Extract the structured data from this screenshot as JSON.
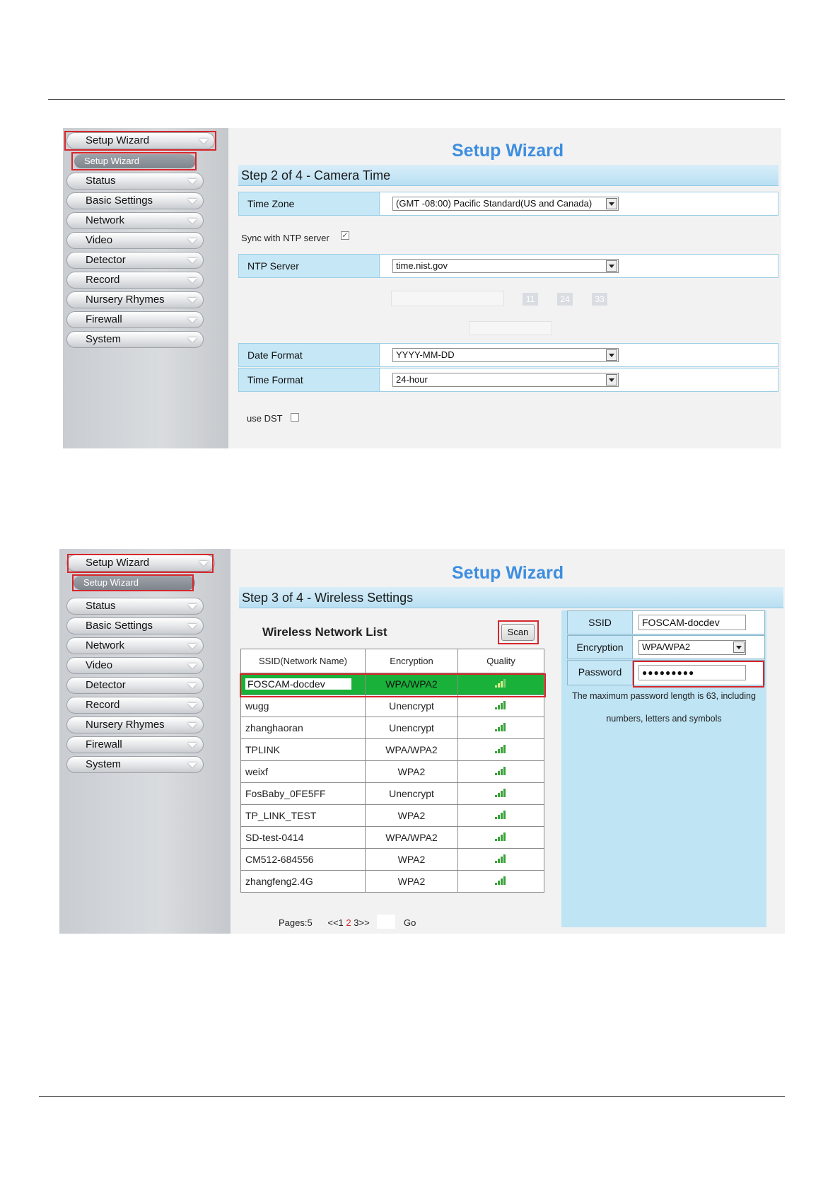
{
  "screen1": {
    "menu": {
      "setup_wizard": "Setup Wizard",
      "sub_setup_wizard": "Setup Wizard",
      "items": [
        "Status",
        "Basic Settings",
        "Network",
        "Video",
        "Detector",
        "Record",
        "Nursery Rhymes",
        "Firewall",
        "System"
      ]
    },
    "title": "Setup Wizard",
    "step": "Step 2 of 4 - Camera Time",
    "time_zone": {
      "label": "Time Zone",
      "value": "(GMT -08:00) Pacific Standard(US and Canada)"
    },
    "sync_ntp": {
      "label": "Sync with NTP server",
      "checked": true
    },
    "ntp_server": {
      "label": "NTP Server",
      "value": "time.nist.gov"
    },
    "time_fields": [
      "11",
      "24",
      "33"
    ],
    "date_format": {
      "label": "Date Format",
      "value": "YYYY-MM-DD"
    },
    "time_format": {
      "label": "Time Format",
      "value": "24-hour"
    },
    "use_dst": {
      "label": "use DST",
      "checked": false
    }
  },
  "screen2": {
    "menu": {
      "setup_wizard": "Setup Wizard",
      "sub_setup_wizard": "Setup Wizard",
      "items": [
        "Status",
        "Basic Settings",
        "Network",
        "Video",
        "Detector",
        "Record",
        "Nursery Rhymes",
        "Firewall",
        "System"
      ]
    },
    "title": "Setup Wizard",
    "step": "Step 3 of 4 - Wireless Settings",
    "list_title": "Wireless Network List",
    "scan_label": "Scan",
    "columns": [
      "SSID(Network Name)",
      "Encryption",
      "Quality"
    ],
    "networks": [
      {
        "ssid": "FOSCAM-docdev",
        "encryption": "WPA/WPA2",
        "quality": 3
      },
      {
        "ssid": "wugg",
        "encryption": "Unencrypt",
        "quality": 4
      },
      {
        "ssid": "zhanghaoran",
        "encryption": "Unencrypt",
        "quality": 4
      },
      {
        "ssid": "TPLINK",
        "encryption": "WPA/WPA2",
        "quality": 4
      },
      {
        "ssid": "weixf",
        "encryption": "WPA2",
        "quality": 4
      },
      {
        "ssid": "FosBaby_0FE5FF",
        "encryption": "Unencrypt",
        "quality": 4
      },
      {
        "ssid": "TP_LINK_TEST",
        "encryption": "WPA2",
        "quality": 4
      },
      {
        "ssid": "SD-test-0414",
        "encryption": "WPA/WPA2",
        "quality": 4
      },
      {
        "ssid": "CM512-684556",
        "encryption": "WPA2",
        "quality": 4
      },
      {
        "ssid": "zhangfeng2.4G",
        "encryption": "WPA2",
        "quality": 4
      }
    ],
    "pager": {
      "pages_label": "Pages:5",
      "prev": "<<1",
      "current": "2",
      "next": "3>>",
      "go_label": "Go"
    },
    "ssid": {
      "label": "SSID",
      "value": "FOSCAM-docdev"
    },
    "encryption": {
      "label": "Encryption",
      "value": "WPA/WPA2"
    },
    "password": {
      "label": "Password",
      "value": "●●●●●●●●●"
    },
    "password_note_1": "The maximum password length is 63, including",
    "password_note_2": "numbers, letters and symbols"
  }
}
